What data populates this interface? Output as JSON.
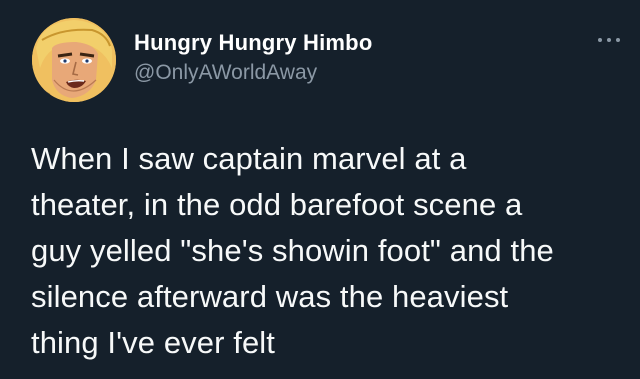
{
  "tweet": {
    "display_name": "Hungry Hungry Himbo",
    "handle": "@OnlyAWorldAway",
    "avatar_icon": "he-man-cartoon-avatar",
    "more_icon": "more-options-icon",
    "text_lines": [
      "When I saw captain marvel at a",
      "theater, in the odd barefoot scene a",
      "guy yelled \"she's showin foot\" and the",
      "silence afterward was the heaviest",
      "thing I've ever felt"
    ]
  },
  "colors": {
    "background": "#15202b",
    "text": "#f7f9f9",
    "secondary": "#8b98a5"
  }
}
